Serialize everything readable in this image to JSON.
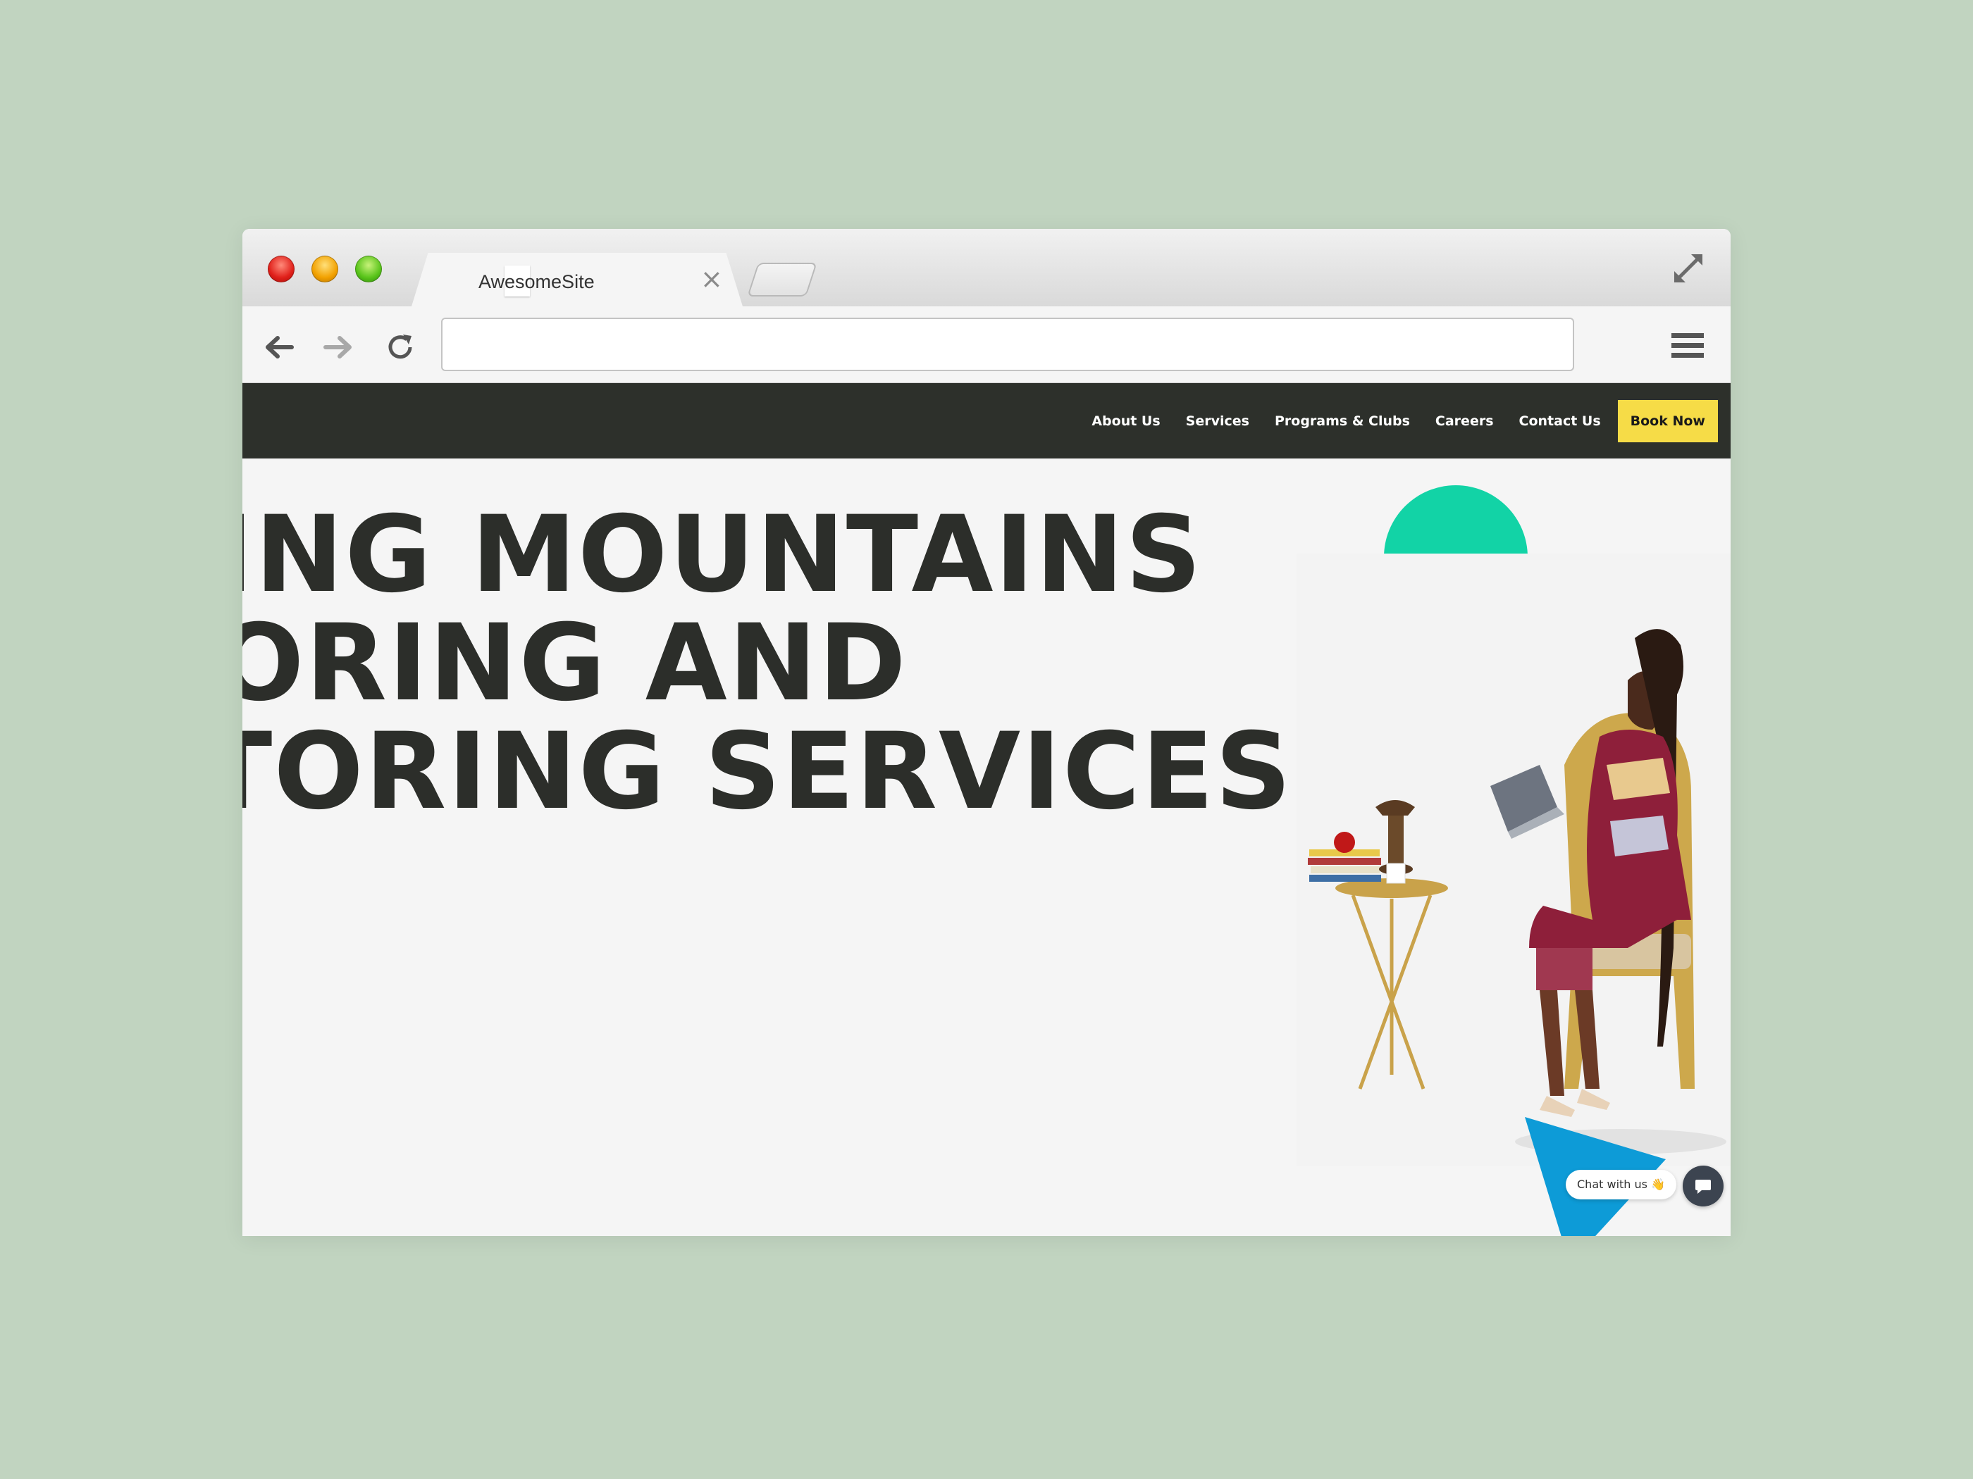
{
  "browser": {
    "tab_title": "AwesomeSite",
    "tab_close": "×",
    "url": ""
  },
  "site_nav": {
    "links": [
      "About Us",
      "Services",
      "Programs & Clubs",
      "Careers",
      "Contact Us"
    ],
    "cta": "Book Now"
  },
  "hero": {
    "lines": [
      "ING MOUNTAINS",
      "ORING AND",
      "TORING SERVICES"
    ]
  },
  "chat": {
    "label": "Chat with us 👋"
  },
  "colors": {
    "background": "#c1d4c0",
    "nav_bg": "#2d302b",
    "cta_yellow": "#f6dc47",
    "circle_green": "#12d3a6",
    "square_peach": "#fbdfae",
    "triangle_blue": "#0d9bd7"
  }
}
